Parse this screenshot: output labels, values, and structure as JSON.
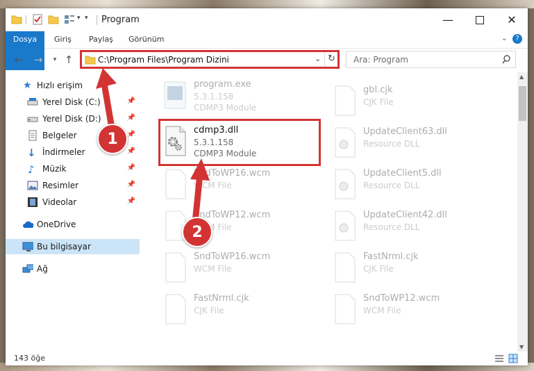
{
  "window": {
    "title": "Program",
    "minimize_icon": "minimize-icon",
    "maximize_icon": "maximize-icon",
    "close_icon": "close-icon"
  },
  "ribbon": {
    "tabs": [
      "Dosya",
      "Giriş",
      "Paylaş",
      "Görünüm"
    ],
    "accent": "#1979ca"
  },
  "address": {
    "path": "C:\\Program Files\\Program Dizini",
    "search_placeholder": "Ara: Program"
  },
  "sidebar": {
    "items": [
      {
        "label": "Hızlı erişim",
        "icon": "star-icon"
      },
      {
        "label": "Yerel Disk (C:)",
        "icon": "drive-icon",
        "pinned": true
      },
      {
        "label": "Yerel Disk (D:)",
        "icon": "drive-icon",
        "pinned": true
      },
      {
        "label": "Belgeler",
        "icon": "documents-icon",
        "pinned": true
      },
      {
        "label": "İndirmeler",
        "icon": "downloads-icon",
        "pinned": true
      },
      {
        "label": "Müzik",
        "icon": "music-icon",
        "pinned": true
      },
      {
        "label": "Resimler",
        "icon": "pictures-icon",
        "pinned": true
      },
      {
        "label": "Videolar",
        "icon": "videos-icon",
        "pinned": true
      },
      {
        "label": "OneDrive",
        "icon": "cloud-icon"
      },
      {
        "label": "Bu bilgisayar",
        "icon": "computer-icon",
        "selected": true
      },
      {
        "label": "Ağ",
        "icon": "network-icon"
      }
    ]
  },
  "files": {
    "left": [
      {
        "name": "program.exe",
        "version": "5.3.1.158",
        "type": "CDMP3 Module",
        "faded": true
      },
      {
        "name": "cdmp3.dll",
        "version": "5.3.1.158",
        "type": "CDMP3 Module",
        "faded": false
      },
      {
        "name": "SndToWP16.wcm",
        "version": "",
        "type": "WCM File",
        "faded": true
      },
      {
        "name": "SndToWP12.wcm",
        "version": "",
        "type": "WCM File",
        "faded": true
      },
      {
        "name": "SndToWP16.wcm",
        "version": "",
        "type": "WCM File",
        "faded": true
      },
      {
        "name": "FastNrml.cjk",
        "version": "",
        "type": "CJK File",
        "faded": true
      }
    ],
    "right": [
      {
        "name": "gbl.cjk",
        "version": "",
        "type": "CJK File",
        "faded": true
      },
      {
        "name": "UpdateClient63.dll",
        "version": "",
        "type": "Resource DLL",
        "faded": true
      },
      {
        "name": "UpdateClient5.dll",
        "version": "",
        "type": "Resource DLL",
        "faded": true
      },
      {
        "name": "UpdateClient42.dll",
        "version": "",
        "type": "Resource DLL",
        "faded": true
      },
      {
        "name": "FastNrml.cjk",
        "version": "",
        "type": "CJK File",
        "faded": true
      },
      {
        "name": "SndToWP12.wcm",
        "version": "",
        "type": "WCM File",
        "faded": true
      }
    ]
  },
  "status": {
    "count": "143 öğe"
  },
  "annotations": {
    "step1": "1",
    "step2": "2",
    "color": "#d23434"
  }
}
